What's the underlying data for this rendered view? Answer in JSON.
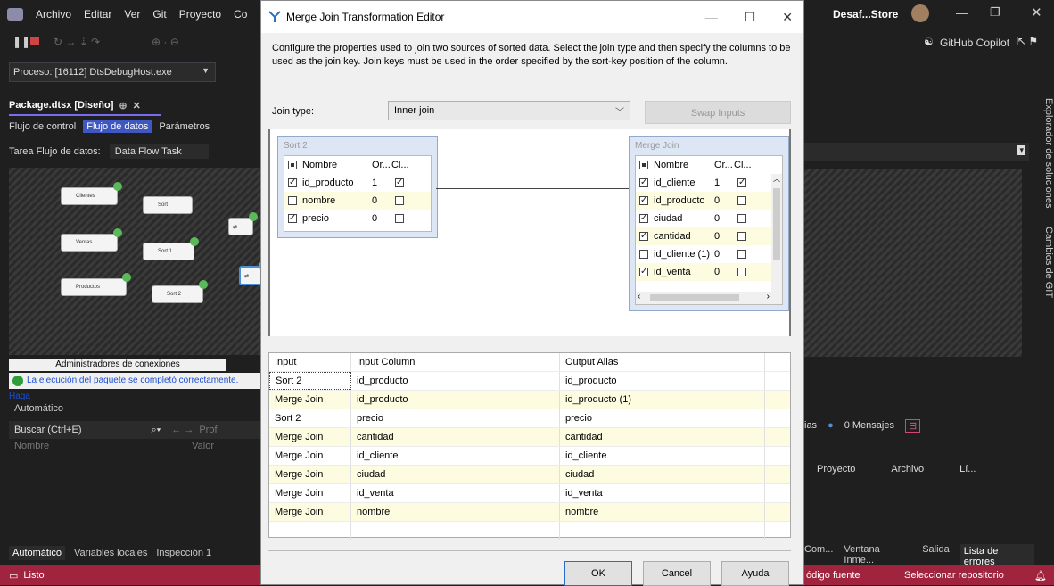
{
  "vs": {
    "menu": [
      "Archivo",
      "Editar",
      "Ver",
      "Git",
      "Proyecto",
      "Co"
    ],
    "right_title": "Desaf...Store",
    "copilot_label": "GitHub Copilot",
    "proceso_label": "Proceso:",
    "proceso_value": "[16112] DtsDebugHost.exe",
    "doc_tab": "Package.dtsx [Diseño]",
    "subtabs": [
      "Flujo de control",
      "Flujo de datos",
      "Parámetros"
    ],
    "task_label": "Tarea Flujo de datos:",
    "task_value": "Data Flow Task",
    "nodes": [
      "Clientes",
      "Sort",
      "Ventas",
      "Sort 1",
      "Productos",
      "Sort 2"
    ],
    "admin_label": "Administradores de conexiones",
    "exec_message": "La ejecución del paquete se completó correctamente. Haga",
    "auto_title": "Automático",
    "search_placeholder": "Buscar (Ctrl+E)",
    "search_extra": "Prof",
    "col_nombre": "Nombre",
    "col_valor": "Valor",
    "bottom_tabs": [
      "Automático",
      "Variables locales",
      "Inspección 1"
    ],
    "status_text": "Listo",
    "side_tabs": [
      "Explorador de soluciones",
      "Cambios de GIT"
    ],
    "msg_prefix": "ias",
    "msg_count": "0 Mensajes",
    "proj_cols": [
      "Proyecto",
      "Archivo",
      "Lí..."
    ],
    "right_bottom_tabs": [
      "Com...",
      "Ventana Inme...",
      "Salida",
      "Lista de errores"
    ],
    "status_right": [
      "ódigo fuente",
      "Seleccionar repositorio"
    ]
  },
  "dialog": {
    "title": "Merge Join Transformation Editor",
    "description": "Configure the properties used to join two sources of sorted data. Select the join type and then specify the columns to be used as the join key. Join keys must be used in the order specified by the sort-key position of the column.",
    "join_type_label": "Join type:",
    "join_type_value": "Inner join",
    "swap_label": "Swap Inputs",
    "left_box": {
      "title": "Sort 2",
      "header": [
        "Nombre",
        "Or...",
        "Cl..."
      ],
      "rows": [
        {
          "name": "id_producto",
          "order": "1",
          "checked": true,
          "key": true
        },
        {
          "name": "nombre",
          "order": "0",
          "checked": false,
          "key": false
        },
        {
          "name": "precio",
          "order": "0",
          "checked": true,
          "key": false
        }
      ]
    },
    "right_box": {
      "title": "Merge Join",
      "header": [
        "Nombre",
        "Or...",
        "Cl..."
      ],
      "rows": [
        {
          "name": "id_cliente",
          "order": "1",
          "checked": true,
          "key": true
        },
        {
          "name": "id_producto",
          "order": "0",
          "checked": true,
          "key": false
        },
        {
          "name": "ciudad",
          "order": "0",
          "checked": true,
          "key": false
        },
        {
          "name": "cantidad",
          "order": "0",
          "checked": true,
          "key": false
        },
        {
          "name": "id_cliente (1)",
          "order": "0",
          "checked": false,
          "key": false
        },
        {
          "name": "id_venta",
          "order": "0",
          "checked": true,
          "key": false
        }
      ]
    },
    "grid": {
      "headers": [
        "Input",
        "Input Column",
        "Output Alias"
      ],
      "rows": [
        [
          "Sort 2",
          "id_producto",
          "id_producto"
        ],
        [
          "Merge Join",
          "id_producto",
          "id_producto (1)"
        ],
        [
          "Sort 2",
          "precio",
          "precio"
        ],
        [
          "Merge Join",
          "cantidad",
          "cantidad"
        ],
        [
          "Merge Join",
          "id_cliente",
          "id_cliente"
        ],
        [
          "Merge Join",
          "ciudad",
          "ciudad"
        ],
        [
          "Merge Join",
          "id_venta",
          "id_venta"
        ],
        [
          "Merge Join",
          "nombre",
          "nombre"
        ]
      ]
    },
    "buttons": {
      "ok": "OK",
      "cancel": "Cancel",
      "help": "Ayuda"
    }
  }
}
